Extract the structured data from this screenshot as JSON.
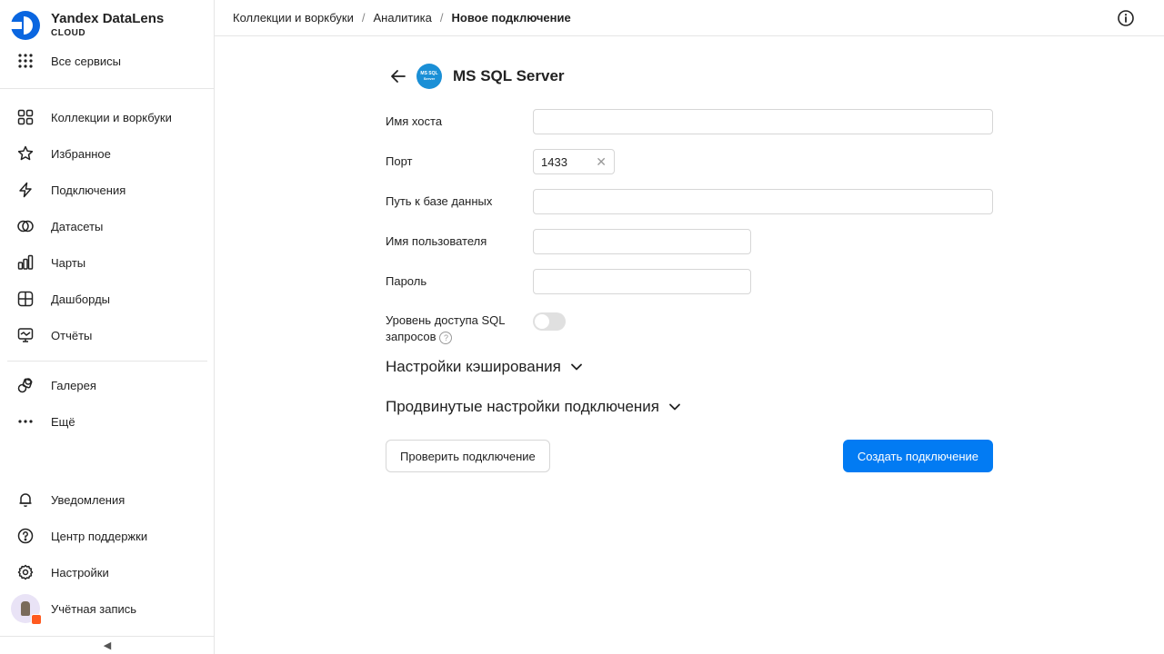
{
  "app": {
    "title": "Yandex DataLens",
    "subtitle": "CLOUD"
  },
  "sidebar": {
    "all_services": "Все сервисы",
    "items": [
      {
        "label": "Коллекции и воркбуки",
        "icon": "grid-icon"
      },
      {
        "label": "Избранное",
        "icon": "star-icon"
      },
      {
        "label": "Подключения",
        "icon": "bolt-icon"
      },
      {
        "label": "Датасеты",
        "icon": "datasets-icon"
      },
      {
        "label": "Чарты",
        "icon": "chart-icon"
      },
      {
        "label": "Дашборды",
        "icon": "dashboard-icon"
      },
      {
        "label": "Отчёты",
        "icon": "report-icon"
      }
    ],
    "secondary": [
      {
        "label": "Галерея",
        "icon": "gallery-icon"
      },
      {
        "label": "Ещё",
        "icon": "more-icon"
      }
    ],
    "bottom": [
      {
        "label": "Уведомления",
        "icon": "bell-icon"
      },
      {
        "label": "Центр поддержки",
        "icon": "help-circle-icon"
      },
      {
        "label": "Настройки",
        "icon": "gear-icon"
      },
      {
        "label": "Учётная запись",
        "icon": "avatar"
      }
    ],
    "collapse_glyph": "◀"
  },
  "header": {
    "breadcrumbs": [
      "Коллекции и воркбуки",
      "Аналитика"
    ],
    "current": "Новое подключение",
    "separator": "/"
  },
  "form": {
    "title": "MS SQL Server",
    "db_logo_text": [
      "MS SQL",
      "Server"
    ],
    "fields": {
      "host": {
        "label": "Имя хоста",
        "value": ""
      },
      "port": {
        "label": "Порт",
        "value": "1433"
      },
      "db_path": {
        "label": "Путь к базе данных",
        "value": ""
      },
      "username": {
        "label": "Имя пользователя",
        "value": ""
      },
      "password": {
        "label": "Пароль",
        "value": ""
      }
    },
    "sql_access": {
      "label_line1": "Уровень доступа SQL",
      "label_line2": "запросов",
      "enabled": false
    },
    "help_glyph": "?",
    "clear_glyph": "✕",
    "sections": {
      "cache": "Настройки кэширования",
      "advanced": "Продвинутые настройки подключения"
    },
    "buttons": {
      "check": "Проверить подключение",
      "create": "Создать подключение"
    }
  },
  "colors": {
    "accent": "#027bf3",
    "db_logo": "#1a8fd6",
    "logo_blue": "#0a66e0"
  }
}
